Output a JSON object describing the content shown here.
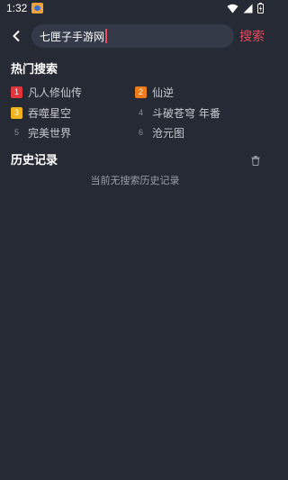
{
  "status_bar": {
    "time": "1:32"
  },
  "search": {
    "query": "七匣子手游网",
    "button_label": "搜索"
  },
  "hot_search": {
    "title": "热门搜索",
    "items": [
      {
        "rank": "1",
        "label": "凡人修仙传",
        "badge_color": "#e0353d"
      },
      {
        "rank": "2",
        "label": "仙逆",
        "badge_color": "#ef7a1a"
      },
      {
        "rank": "3",
        "label": "吞噬星空",
        "badge_color": "#f0b21d"
      },
      {
        "rank": "4",
        "label": "斗破苍穹 年番",
        "badge_color": ""
      },
      {
        "rank": "5",
        "label": "完美世界",
        "badge_color": ""
      },
      {
        "rank": "6",
        "label": "沧元图",
        "badge_color": ""
      }
    ]
  },
  "history": {
    "title": "历史记录",
    "empty_text": "当前无搜索历史记录"
  }
}
